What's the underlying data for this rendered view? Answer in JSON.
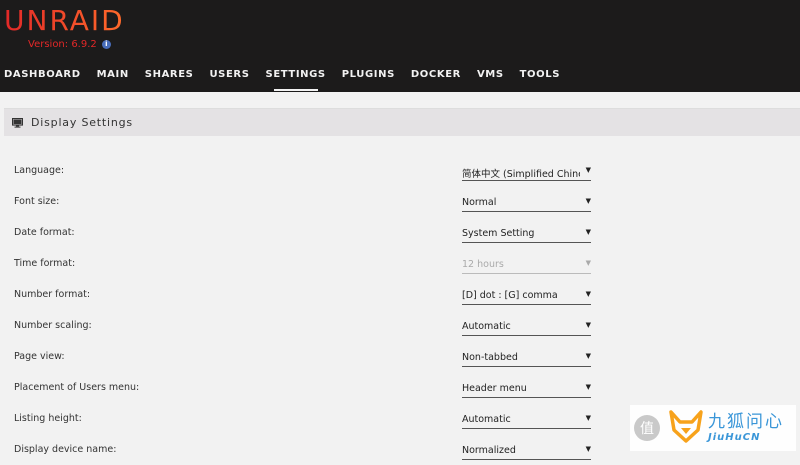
{
  "header": {
    "logo": "UNRAID",
    "version": "Version: 6.9.2",
    "nav": [
      {
        "label": "DASHBOARD",
        "active": false
      },
      {
        "label": "MAIN",
        "active": false
      },
      {
        "label": "SHARES",
        "active": false
      },
      {
        "label": "USERS",
        "active": false
      },
      {
        "label": "SETTINGS",
        "active": true
      },
      {
        "label": "PLUGINS",
        "active": false
      },
      {
        "label": "DOCKER",
        "active": false
      },
      {
        "label": "VMS",
        "active": false
      },
      {
        "label": "TOOLS",
        "active": false
      }
    ]
  },
  "panel": {
    "title": "Display Settings"
  },
  "settings": [
    {
      "label": "Language:",
      "value": "简体中文 (Simplified Chinese)",
      "disabled": false
    },
    {
      "label": "Font size:",
      "value": "Normal",
      "disabled": false
    },
    {
      "label": "Date format:",
      "value": "System Setting",
      "disabled": false
    },
    {
      "label": "Time format:",
      "value": "12 hours",
      "disabled": true
    },
    {
      "label": "Number format:",
      "value": "[D] dot : [G] comma",
      "disabled": false
    },
    {
      "label": "Number scaling:",
      "value": "Automatic",
      "disabled": false
    },
    {
      "label": "Page view:",
      "value": "Non-tabbed",
      "disabled": false
    },
    {
      "label": "Placement of Users menu:",
      "value": "Header menu",
      "disabled": false
    },
    {
      "label": "Listing height:",
      "value": "Automatic",
      "disabled": false
    },
    {
      "label": "Display device name:",
      "value": "Normalized",
      "disabled": false
    }
  ],
  "watermark": {
    "badge": "值",
    "cn": "九狐问心",
    "en": "JiuHuCN"
  },
  "colors": {
    "header_bg": "#1c1b1b",
    "brand_red": "#e22828",
    "brand_orange": "#ff6b2b",
    "page_bg": "#f2f2f2"
  }
}
